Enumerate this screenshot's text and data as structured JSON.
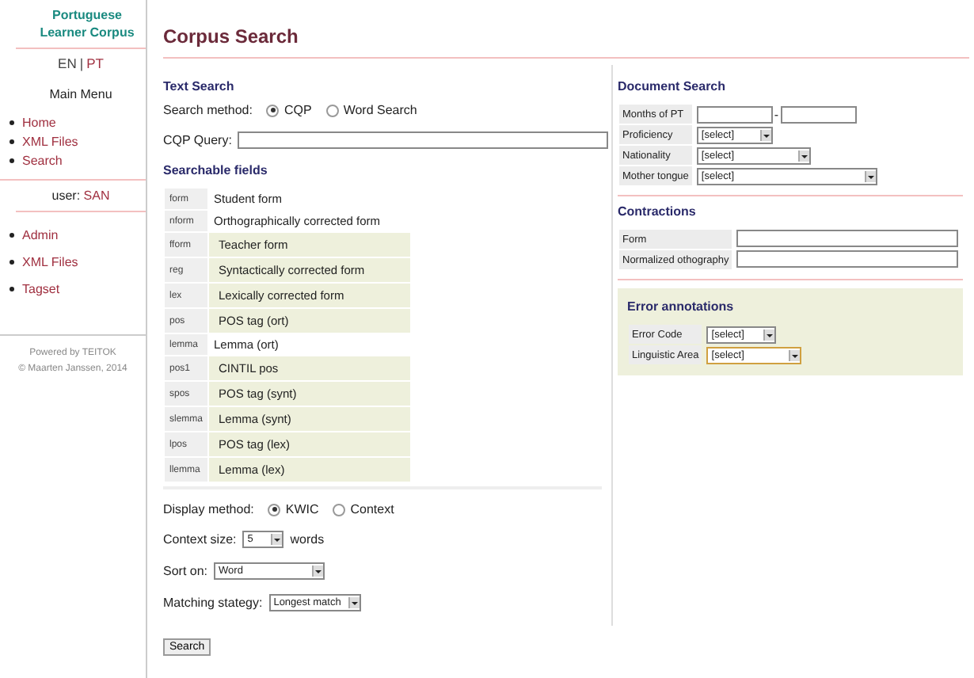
{
  "sidebar": {
    "title": "Portuguese Learner Corpus",
    "languages": [
      {
        "label": "EN",
        "selected": true
      },
      {
        "label": "PT",
        "selected": false
      }
    ],
    "language_separator": "|",
    "menu_title": "Main Menu",
    "menu": [
      "Home",
      "XML Files",
      "Search"
    ],
    "user_label": "user:",
    "user": "SAN",
    "admin_menu": [
      "Admin",
      "XML Files",
      "Tagset"
    ],
    "footer": [
      "Powered by TEITOK",
      "© Maarten Janssen, 2014"
    ]
  },
  "page_title": "Corpus Search",
  "text_search": {
    "title": "Text Search",
    "method_label": "Search method:",
    "methods": [
      {
        "label": "CQP",
        "selected": true
      },
      {
        "label": "Word Search",
        "selected": false
      }
    ],
    "query_label": "CQP Query:",
    "fields_title": "Searchable fields",
    "fields": [
      {
        "code": "form",
        "label": "Student form",
        "highlighted": false
      },
      {
        "code": "nform",
        "label": "Orthographically corrected form",
        "highlighted": false
      },
      {
        "code": "fform",
        "label": "Teacher form",
        "highlighted": true
      },
      {
        "code": "reg",
        "label": "Syntactically corrected form",
        "highlighted": true
      },
      {
        "code": "lex",
        "label": "Lexically corrected form",
        "highlighted": true
      },
      {
        "code": "pos",
        "label": "POS tag (ort)",
        "highlighted": true
      },
      {
        "code": "lemma",
        "label": "Lemma (ort)",
        "highlighted": false
      },
      {
        "code": "pos1",
        "label": "CINTIL pos",
        "highlighted": true
      },
      {
        "code": "spos",
        "label": "POS tag (synt)",
        "highlighted": true
      },
      {
        "code": "slemma",
        "label": "Lemma (synt)",
        "highlighted": true
      },
      {
        "code": "lpos",
        "label": "POS tag (lex)",
        "highlighted": true
      },
      {
        "code": "llemma",
        "label": "Lemma (lex)",
        "highlighted": true
      }
    ],
    "display_label": "Display method:",
    "display_methods": [
      {
        "label": "KWIC",
        "selected": true
      },
      {
        "label": "Context",
        "selected": false
      }
    ],
    "context_label": "Context size:",
    "context_value": "5",
    "context_unit": "words",
    "sort_label": "Sort on:",
    "sort_value": "Word",
    "matching_label": "Matching stategy:",
    "matching_value": "Longest match",
    "search_button": "Search"
  },
  "document_search": {
    "title": "Document Search",
    "months_label": "Months of PT",
    "range_sep": "-",
    "selects": [
      {
        "label": "Proficiency",
        "value": "[select]"
      },
      {
        "label": "Nationality",
        "value": "[select]"
      },
      {
        "label": "Mother tongue",
        "value": "[select]"
      }
    ]
  },
  "contractions": {
    "title": "Contractions",
    "fields": [
      "Form",
      "Normalized othography"
    ]
  },
  "error_annotations": {
    "title": "Error annotations",
    "selects": [
      {
        "label": "Error Code",
        "value": "[select]",
        "focused": false
      },
      {
        "label": "Linguistic Area",
        "value": "[select]",
        "focused": true
      }
    ]
  }
}
